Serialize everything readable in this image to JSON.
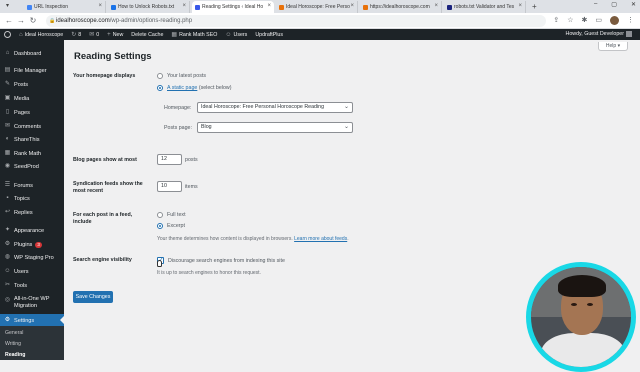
{
  "browser": {
    "tabs": [
      {
        "title": "URL Inspection",
        "color": "#4285f4"
      },
      {
        "title": "How to Unlock Robots.txt",
        "color": "#1a73e8"
      },
      {
        "title": "Reading Settings ‹ Ideal Ho",
        "color": "#3858e9",
        "active": true
      },
      {
        "title": "Ideal Horoscope: Free Perso",
        "color": "#e8710a"
      },
      {
        "title": "https://idealhoroscope.com",
        "color": "#e8710a"
      },
      {
        "title": "robots.txt Validator and Tes",
        "color": "#1a237e"
      }
    ],
    "new_tab": "+",
    "url_host": "idealhoroscope.com",
    "url_path": "/wp-admin/options-reading.php"
  },
  "adminbar": {
    "site_name": "Ideal Horoscope",
    "updates_count": "8",
    "comments_count": "0",
    "new_label": "New",
    "delete_cache": "Delete Cache",
    "rank_math": "Rank Math SEO",
    "users": "Users",
    "updraft": "UpdraftPlus",
    "howdy": "Howdy, Guest Developer"
  },
  "sidebar": {
    "items": [
      {
        "label": "Dashboard",
        "icon": "⌂"
      },
      {
        "label": "File Manager",
        "icon": "▤"
      },
      {
        "label": "Posts",
        "icon": "✎"
      },
      {
        "label": "Media",
        "icon": "▣"
      },
      {
        "label": "Pages",
        "icon": "▯"
      },
      {
        "label": "Comments",
        "icon": "✉"
      },
      {
        "label": "ShareThis",
        "icon": "◐"
      },
      {
        "label": "Rank Math",
        "icon": "▦"
      },
      {
        "label": "SeedProd",
        "icon": "◉"
      },
      {
        "label": "Forums",
        "icon": "☰"
      },
      {
        "label": "Topics",
        "icon": "▪"
      },
      {
        "label": "Replies",
        "icon": "↩"
      },
      {
        "label": "Appearance",
        "icon": "✦"
      },
      {
        "label": "Plugins",
        "icon": "⚙",
        "badge": "3"
      },
      {
        "label": "WP Staging Pro",
        "icon": "◍"
      },
      {
        "label": "Users",
        "icon": "☺"
      },
      {
        "label": "Tools",
        "icon": "✂"
      },
      {
        "label": "All-in-One WP Migration",
        "icon": "◎"
      },
      {
        "label": "Settings",
        "icon": "⚙"
      }
    ],
    "submenu": [
      "General",
      "Writing",
      "Reading"
    ]
  },
  "page": {
    "title": "Reading Settings",
    "help": "Help ▾",
    "homepage_displays_label": "Your homepage displays",
    "latest_posts": "Your latest posts",
    "static_page_link": "A static page",
    "static_page_suffix": "(select below)",
    "homepage_label": "Homepage:",
    "homepage_value": "Ideal Horoscope: Free Personal Horoscope Reading",
    "posts_page_label": "Posts page:",
    "posts_page_value": "Blog",
    "blog_pages_label": "Blog pages show at most",
    "blog_pages_value": "12",
    "blog_pages_unit": "posts",
    "syndication_label": "Syndication feeds show the most recent",
    "syndication_value": "10",
    "syndication_unit": "items",
    "feed_label": "For each post in a feed, include",
    "full_text": "Full text",
    "excerpt": "Excerpt",
    "theme_note": "Your theme determines how content is displayed in browsers.",
    "learn_more": "Learn more about feeds",
    "search_vis_label": "Search engine visibility",
    "discourage": "Discourage search engines from indexing this site",
    "honor_note": "It is up to search engines to honor this request.",
    "save": "Save Changes"
  }
}
